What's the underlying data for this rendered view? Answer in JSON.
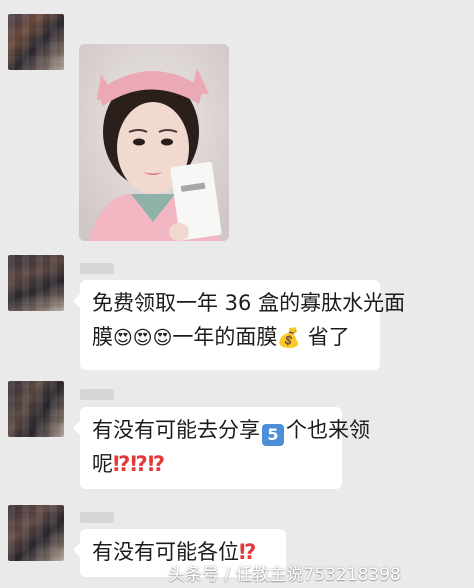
{
  "messages": [
    {
      "type": "image",
      "alt": "selfie"
    },
    {
      "type": "text",
      "line1": "免费领取一年 36 盒的寡肽水光面",
      "line2_text_a": "膜",
      "emojis_a": "😍😍😍",
      "line2_text_b": "一年的面膜",
      "emoji_money": "💰",
      "line2_text_c": " 省了"
    },
    {
      "type": "text",
      "line1_a": "有没有可能去分享",
      "keycap": "5",
      "line1_b": "个也来领",
      "line2_a": "呢",
      "marks": "⁉⁉⁉"
    },
    {
      "type": "text",
      "line1_a": "有没有可能各位",
      "marks": "⁉"
    }
  ],
  "watermark": "头条号 / 任教主说753218398",
  "colors": {
    "background": "#eaeaea",
    "bubble": "#ffffff",
    "accent_red": "#e23a3a"
  }
}
